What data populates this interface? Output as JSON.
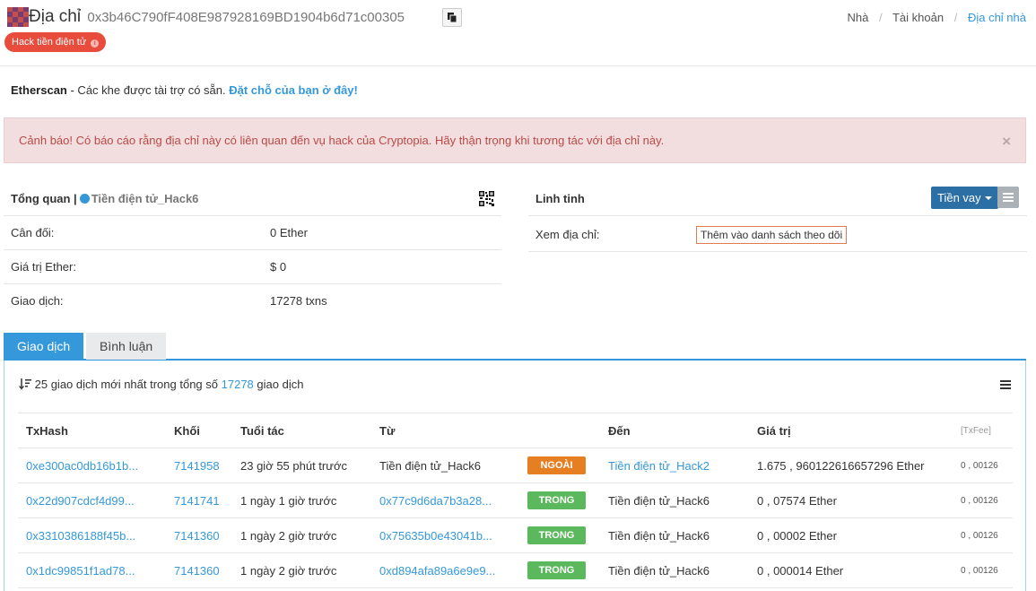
{
  "header": {
    "title": "Địa chỉ",
    "address": "0x3b46C790fF408E987928169BD1904b6d71c00305",
    "badge": "Hack tiền điện tử",
    "badge_info": "i",
    "breadcrumb": [
      "Nhà",
      "Tài khoản",
      "Địa chỉ nhà"
    ]
  },
  "sponsor": {
    "brand": "Etherscan",
    "text": " - Các khe được tài trợ có sẵn. ",
    "link": "Đặt chỗ của bạn ở đây!"
  },
  "alert": {
    "text": "Cảnh báo! Có báo cáo rằng địa chỉ này có liên quan đến vụ hack của Cryptopia. Hãy thận trọng khi tương tác với địa chỉ này.",
    "close": "×"
  },
  "overview": {
    "title": "Tổng quan |",
    "tag": "Tiền điện tử_Hack6",
    "rows": [
      {
        "label": "Cân đối:",
        "value": "0 Ether"
      },
      {
        "label": "Giá trị Ether:",
        "value": "$ 0"
      },
      {
        "label": "Giao dịch:",
        "value": "17278 txns"
      }
    ]
  },
  "misc": {
    "title": "Linh tinh",
    "loan_button": "Tiền vay",
    "watch_label": "Xem địa chỉ:",
    "watch_button": "Thêm vào danh sách theo dõi"
  },
  "tabs": [
    "Giao dịch",
    "Bình luận"
  ],
  "transactions": {
    "summary_prefix": "25 giao dịch mới nhất trong tổng số",
    "summary_count": "17278",
    "summary_suffix": "giao dịch",
    "headers": [
      "TxHash",
      "Khối",
      "Tuổi tác",
      "Từ",
      "",
      "Đến",
      "Giá trị",
      "[TxFee]"
    ],
    "rows": [
      {
        "hash": "0xe300ac0db16b1b...",
        "block": "7141958",
        "age": "23 giờ 55 phút trước",
        "from": "Tiền điện tử_Hack6",
        "dir": "NGOÀI",
        "to": "Tiền điện tử_Hack2",
        "value": "1.675 , 960122616657296 Ether",
        "fee": "0 , 00126"
      },
      {
        "hash": "0x22d907cdcf4d99...",
        "block": "7141741",
        "age": "1 ngày 1 giờ trước",
        "from": "0x77c9d6da7b3a28...",
        "dir": "TRONG",
        "to": "Tiền điện tử_Hack6",
        "value": "0 , 07574 Ether",
        "fee": "0 , 00126"
      },
      {
        "hash": "0x3310386188f45b...",
        "block": "7141360",
        "age": "1 ngày 2 giờ trước",
        "from": "0x75635b0e43041b...",
        "dir": "TRONG",
        "to": "Tiền điện tử_Hack6",
        "value": "0 , 00002 Ether",
        "fee": "0 , 00126"
      },
      {
        "hash": "0x1dc99851f1ad78...",
        "block": "7141360",
        "age": "1 ngày 2 giờ trước",
        "from": "0xd894afa89a6e9e9...",
        "dir": "TRONG",
        "to": "Tiền điện tử_Hack6",
        "value": "0 , 000014 Ether",
        "fee": "0 , 00126"
      }
    ]
  },
  "colors": {
    "link": "#3498db",
    "badge": "#e74c3c",
    "alert_bg": "#f2dede",
    "alert_text": "#b94a48",
    "out": "#e67e22",
    "in": "#5cb85c",
    "loan_button": "#2c6fa5"
  }
}
